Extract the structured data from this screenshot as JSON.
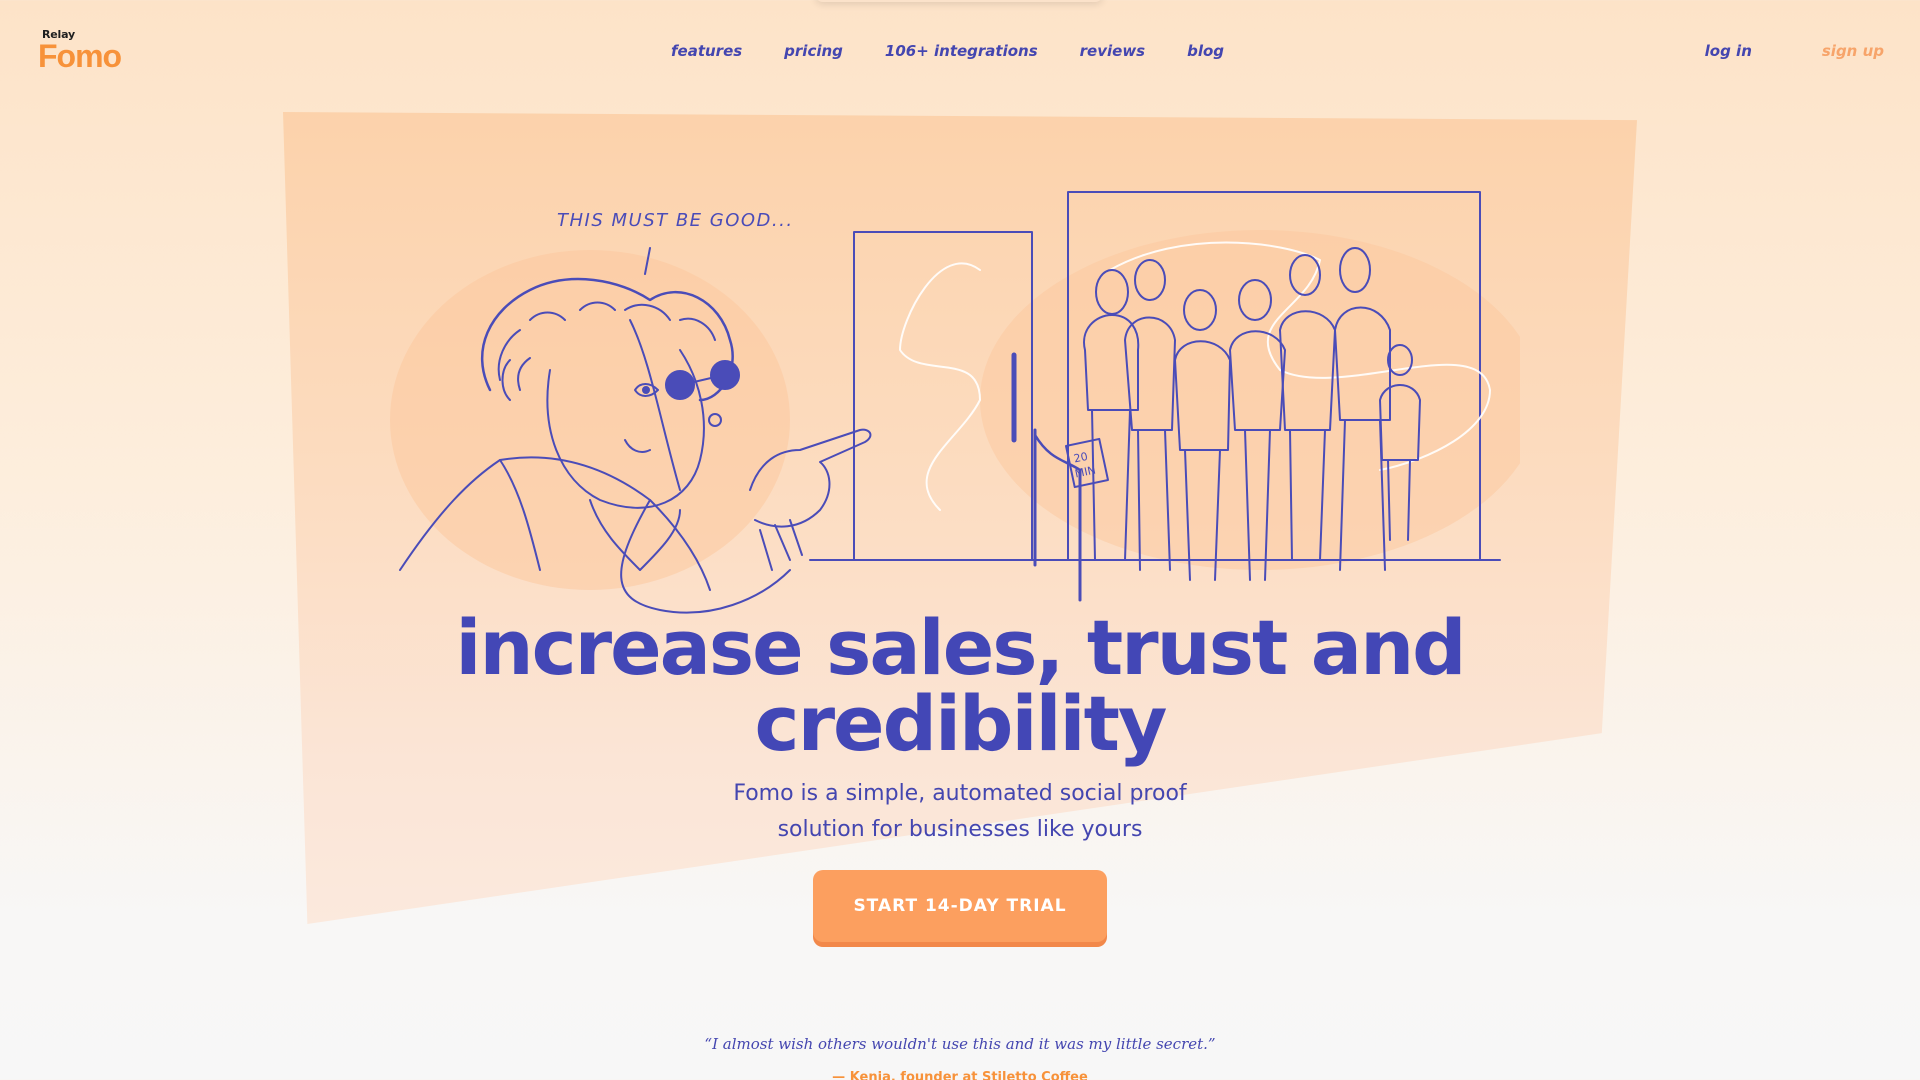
{
  "brand": {
    "parent": "Relay",
    "name": "Fomo",
    "accent_color": "#f7923a",
    "text_color": "#4446b0"
  },
  "nav": {
    "items": [
      {
        "label": "features"
      },
      {
        "label": "pricing"
      },
      {
        "label": "106+ integrations"
      },
      {
        "label": "reviews"
      },
      {
        "label": "blog"
      }
    ]
  },
  "auth": {
    "login_label": "log in",
    "signup_label": "sign up"
  },
  "hero": {
    "illustration_caption": "THIS MUST BE GOOD...",
    "sign_text_line1": "20",
    "sign_text_line2": "MIN",
    "headline_line1": "increase sales, trust and",
    "headline_line2": "credibility",
    "subtitle_line1": "Fomo is a simple, automated social proof",
    "subtitle_line2": "solution for businesses like yours",
    "cta_label": "START 14-DAY TRIAL"
  },
  "testimonial": {
    "quote": "“I almost wish others wouldn't use this and it was my little secret.”",
    "author": "— Kenia, founder at Stiletto Coffee"
  }
}
